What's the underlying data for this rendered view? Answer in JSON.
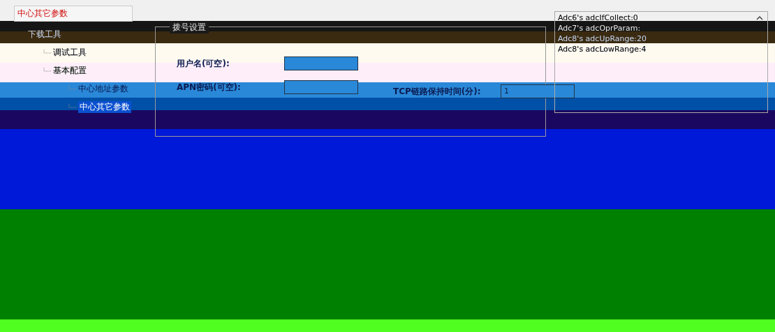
{
  "selector": {
    "value": "中心其它参数"
  },
  "tree": [
    {
      "label": "下载工具",
      "selected": false,
      "children": [
        {
          "label": "调试工具",
          "selected": false
        },
        {
          "label": "基本配置",
          "selected": false,
          "children": [
            {
              "label": "中心地址参数",
              "selected": false
            },
            {
              "label": "中心其它参数",
              "selected": true
            }
          ]
        }
      ]
    }
  ],
  "dial_group": {
    "title": "拨号设置",
    "left_fields": [
      {
        "label": "用户名(可空):"
      },
      {
        "label": "APN密码(可空):"
      }
    ],
    "right_fields": [
      {
        "label": "TCP链路保持时间(分):",
        "value": "1"
      }
    ]
  },
  "log_lines": [
    "Adc6's adcIfCollect:0",
    "Adc7's adcOprParam:",
    "Adc8's adcUpRange:20",
    "Adc8's adcLowRange:4"
  ]
}
